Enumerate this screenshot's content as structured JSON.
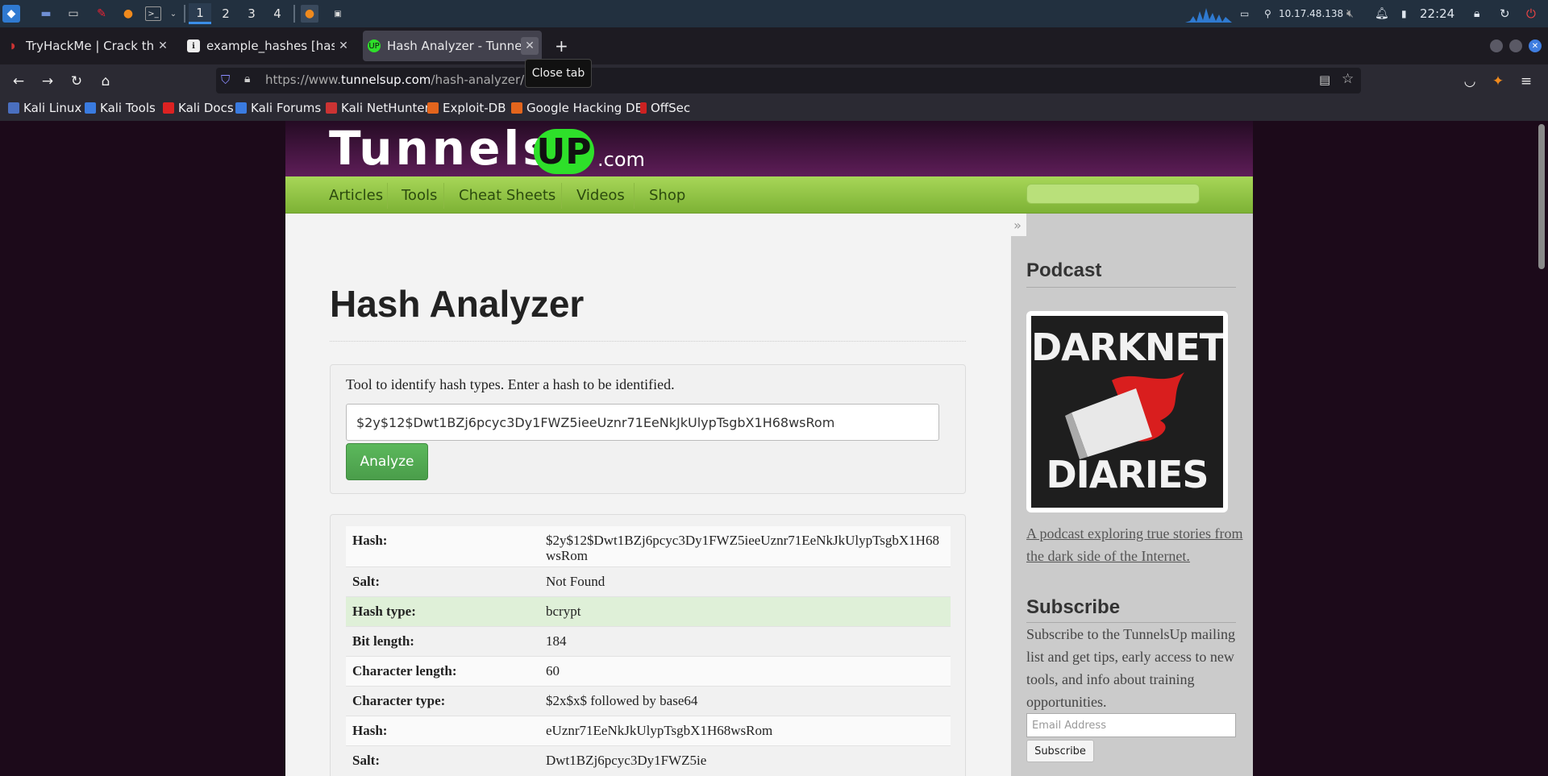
{
  "taskbar": {
    "workspaces": [
      "1",
      "2",
      "3",
      "4"
    ],
    "ip": "10.17.48.138",
    "clock": "22:24"
  },
  "tabs": [
    {
      "title": "TryHackMe | Crack the hash"
    },
    {
      "title": "example_hashes [hashcat wiki]"
    },
    {
      "title": "Hash Analyzer - TunnelsUP"
    }
  ],
  "tooltip": "Close tab",
  "url": {
    "prefix": "https://www.",
    "domain": "tunnelsup.com",
    "path": "/hash-analyzer/"
  },
  "bookmarks": [
    "Kali Linux",
    "Kali Tools",
    "Kali Docs",
    "Kali Forums",
    "Kali NetHunter",
    "Exploit-DB",
    "Google Hacking DB",
    "OffSec"
  ],
  "site": {
    "logo_main": "Tunnels",
    "logo_up": "UP",
    "logo_com": ".com",
    "menu": [
      "Articles",
      "Tools",
      "Cheat Sheets",
      "Videos",
      "Shop"
    ],
    "collapse": "»"
  },
  "main": {
    "title": "Hash Analyzer",
    "description": "Tool to identify hash types. Enter a hash to be identified.",
    "input_value": "$2y$12$Dwt1BZj6pcyc3Dy1FWZ5ieeUznr71EeNkJkUlypTsgbX1H68wsRom",
    "analyze_label": "Analyze",
    "results": [
      {
        "key": "Hash:",
        "value": "$2y$12$Dwt1BZj6pcyc3Dy1FWZ5ieeUznr71EeNkJkUlypTsgbX1H68wsRom"
      },
      {
        "key": "Salt:",
        "value": "Not Found"
      },
      {
        "key": "Hash type:",
        "value": "bcrypt"
      },
      {
        "key": "Bit length:",
        "value": "184"
      },
      {
        "key": "Character length:",
        "value": "60"
      },
      {
        "key": "Character type:",
        "value": "$2x$x$ followed by base64"
      },
      {
        "key": "Hash:",
        "value": "eUznr71EeNkJkUlypTsgbX1H68wsRom"
      },
      {
        "key": "Salt:",
        "value": "Dwt1BZj6pcyc3Dy1FWZ5ie"
      }
    ]
  },
  "sidebar": {
    "podcast_heading": "Podcast",
    "podcast_art_top": "DARKNET",
    "podcast_art_bottom": "DIARIES",
    "podcast_desc": "A podcast exploring true stories from the dark side of the Internet.",
    "subscribe_heading": "Subscribe",
    "subscribe_text": "Subscribe to the TunnelsUp mailing list and get tips, early access to new tools, and info about training opportunities.",
    "email_placeholder": "Email Address",
    "subscribe_button": "Subscribe"
  }
}
